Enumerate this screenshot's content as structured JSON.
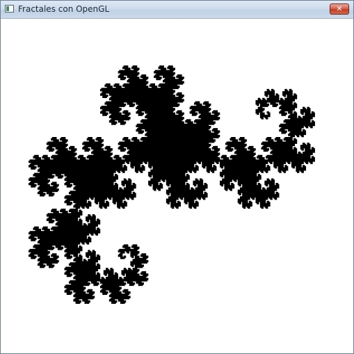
{
  "window": {
    "title": "Fractales con OpenGL",
    "close_glyph": "✕"
  },
  "icons": {
    "app": "app-window-icon",
    "close": "close-icon"
  },
  "colors": {
    "fractal_fill": "#000000",
    "background": "#ffffff",
    "titlebar": "#cfdcec",
    "close_button": "#c13d22"
  },
  "fractal": {
    "name": "Heighway dragon",
    "iterations": 15
  }
}
